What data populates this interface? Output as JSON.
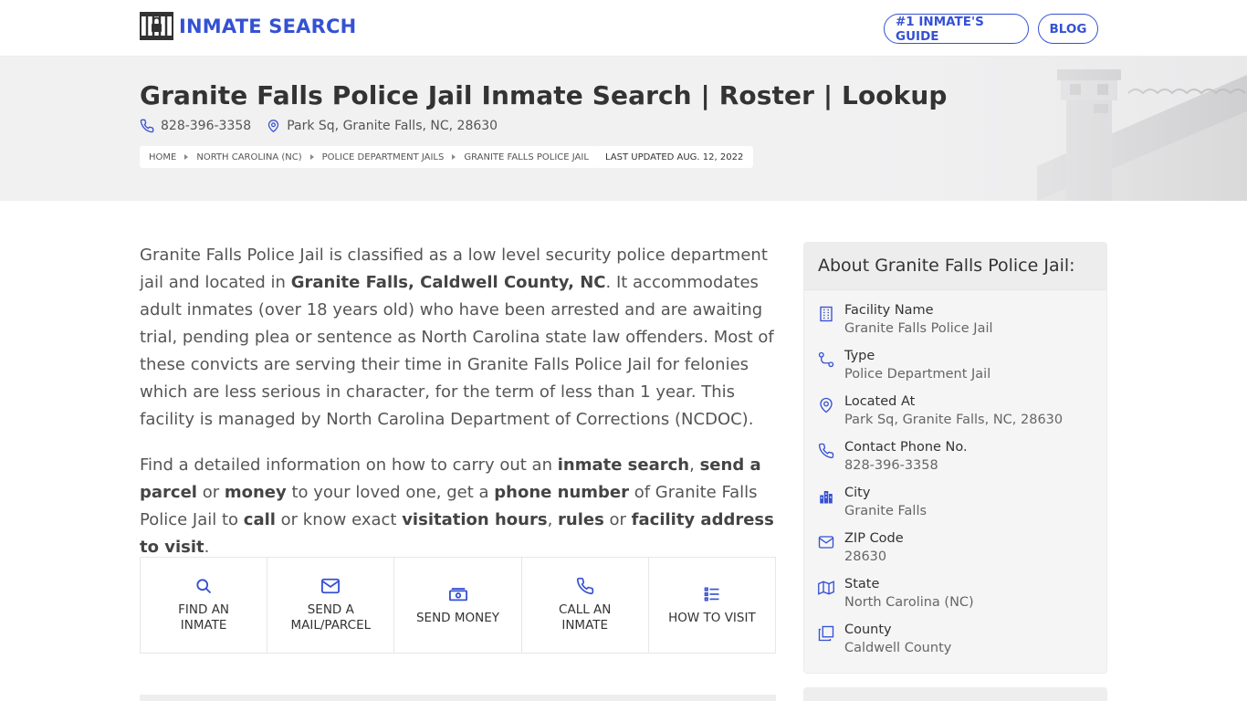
{
  "header": {
    "logo_text": "INMATE SEARCH",
    "nav": [
      {
        "label": "#1 INMATE'S GUIDE"
      },
      {
        "label": "BLOG"
      }
    ]
  },
  "hero": {
    "title": "Granite Falls Police Jail Inmate Search | Roster | Lookup",
    "phone": "828-396-3358",
    "address": "Park Sq, Granite Falls, NC, 28630",
    "breadcrumbs": [
      "HOME",
      "NORTH CAROLINA (NC)",
      "POLICE DEPARTMENT JAILS",
      "GRANITE FALLS POLICE JAIL"
    ],
    "last_updated": "LAST UPDATED AUG. 12, 2022"
  },
  "intro": {
    "p1_a": "Granite Falls Police Jail is classified as a low level security police department jail and located in ",
    "p1_b": "Granite Falls, Caldwell County, NC",
    "p1_c": ". It accommodates adult inmates (over 18 years old) who have been arrested and are awaiting trial, pending plea or sentence as North Carolina state law offenders. Most of these convicts are serving their time in Granite Falls Police Jail for felonies which are less serious in character, for the term of less than 1 year. This facility is managed by North Carolina Department of Corrections (NCDOC).",
    "p2": [
      {
        "t": "Find a detailed information on how to carry out an ",
        "b": false
      },
      {
        "t": "inmate search",
        "b": true
      },
      {
        "t": ", ",
        "b": false
      },
      {
        "t": "send a parcel",
        "b": true
      },
      {
        "t": " or ",
        "b": false
      },
      {
        "t": "money",
        "b": true
      },
      {
        "t": " to your loved one, get a ",
        "b": false
      },
      {
        "t": "phone number",
        "b": true
      },
      {
        "t": " of Granite Falls Police Jail to ",
        "b": false
      },
      {
        "t": "call",
        "b": true
      },
      {
        "t": " or know exact ",
        "b": false
      },
      {
        "t": "visitation hours",
        "b": true
      },
      {
        "t": ", ",
        "b": false
      },
      {
        "t": "rules",
        "b": true
      },
      {
        "t": " or ",
        "b": false
      },
      {
        "t": "facility address to visit",
        "b": true
      },
      {
        "t": ".",
        "b": false
      }
    ]
  },
  "actions": [
    {
      "line1": "FIND AN",
      "line2": "INMATE",
      "icon": "search-icon"
    },
    {
      "line1": "SEND A",
      "line2": "MAIL/PARCEL",
      "icon": "mail-icon"
    },
    {
      "line1": "SEND MONEY",
      "line2": "",
      "icon": "money-icon"
    },
    {
      "line1": "CALL AN",
      "line2": "INMATE",
      "icon": "phone-icon"
    },
    {
      "line1": "HOW TO VISIT",
      "line2": "",
      "icon": "list-icon"
    }
  ],
  "sidebar": {
    "title": "About Granite Falls Police Jail:",
    "rows": [
      {
        "label": "Facility Name",
        "value": "Granite Falls Police Jail",
        "icon": "building-icon"
      },
      {
        "label": "Type",
        "value": "Police Department Jail",
        "icon": "route-icon"
      },
      {
        "label": "Located At",
        "value": "Park Sq, Granite Falls, NC, 28630",
        "icon": "location-pin-icon"
      },
      {
        "label": "Contact Phone No.",
        "value": "828-396-3358",
        "icon": "phone-icon"
      },
      {
        "label": "City",
        "value": "Granite Falls",
        "icon": "city-icon"
      },
      {
        "label": "ZIP Code",
        "value": "28630",
        "icon": "envelope-icon"
      },
      {
        "label": "State",
        "value": "North Carolina (NC)",
        "icon": "map-icon"
      },
      {
        "label": "County",
        "value": "Caldwell County",
        "icon": "copy-icon"
      }
    ]
  },
  "colors": {
    "accent": "#3551d3",
    "hero_bg": "#f1f1f2",
    "text": "#555555"
  }
}
